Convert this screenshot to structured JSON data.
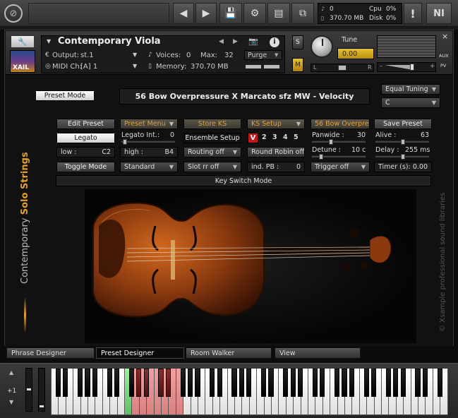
{
  "topbar": {
    "voice_count": "0",
    "memory": "370.70 MB",
    "cpu_label": "Cpu",
    "cpu_value": "0%",
    "disk_label": "Disk",
    "disk_value": "0%",
    "ni_logo": "NI",
    "alert": "!"
  },
  "header": {
    "logo": "XAIL",
    "instrument_name": "Contemporary Viola",
    "output_label": "Output:",
    "output_value": "st.1",
    "midi_label": "MIDI Ch:",
    "midi_value": "[A]  1",
    "voices_label": "Voices:",
    "voices_value": "0",
    "max_label": "Max:",
    "max_value": "32",
    "purge_label": "Purge",
    "memory_label": "Memory:",
    "memory_value": "370.70 MB",
    "tune_label": "Tune",
    "tune_value": "0.00",
    "s_label": "S",
    "m_label": "M",
    "l_label": "L",
    "r_label": "R",
    "aux_label": "AUX",
    "pv_label": "PV",
    "close": "×"
  },
  "panel": {
    "preset_mode": "Preset Mode",
    "preset_display": "56 Bow Overpressure X Marcato sfz MW - Velocity",
    "equal_tuning": "Equal Tuning",
    "key": "C",
    "edit_preset": "Edit Preset",
    "preset_menu": "Preset Menu",
    "store_ks": "Store KS",
    "ks_setup": "KS Setup",
    "bow_overpressure": "56 Bow Overpress",
    "save_preset": "Save Preset",
    "legato": "Legato",
    "legato_int_label": "Legato Int.:",
    "legato_int_value": "0",
    "ensemble_setup": "Ensemble Setup",
    "ks_v": "V",
    "ks_2": "2",
    "ks_3": "3",
    "ks_4": "4",
    "ks_5": "5",
    "panwide_label": "Panwide :",
    "panwide_value": "30",
    "alive_label": "Alive :",
    "alive_value": "63",
    "low_label": "low :",
    "low_value": "C2",
    "high_label": "high :",
    "high_value": "B4",
    "routing_off": "Routing off",
    "round_robin_off": "Round Robin off",
    "detune_label": "Detune :",
    "detune_value": "10 c",
    "delay_label": "Delay :",
    "delay_value": "255 ms",
    "toggle_mode": "Toggle Mode",
    "standard": "Standard",
    "slot_rr_off": "Slot rr off",
    "ind_pb_label": "ind. PB :",
    "ind_pb_value": "0",
    "trigger_off": "Trigger off",
    "timer_label": "Timer (s):",
    "timer_value": "0.00",
    "key_switch_mode": "Key Switch Mode",
    "side_title_1": "Contemporary",
    "side_title_2": "Solo Strings",
    "copyright": "© Xsample professional sound libraries"
  },
  "tabs": [
    "Phrase Designer",
    "Preset Designer",
    "Room Walker",
    "View"
  ],
  "keyboard": {
    "octave": "+1"
  },
  "colors": {
    "accent_orange": "#e0a040",
    "ks_red": "#c01818",
    "tune_yellow": "#d8b020"
  }
}
